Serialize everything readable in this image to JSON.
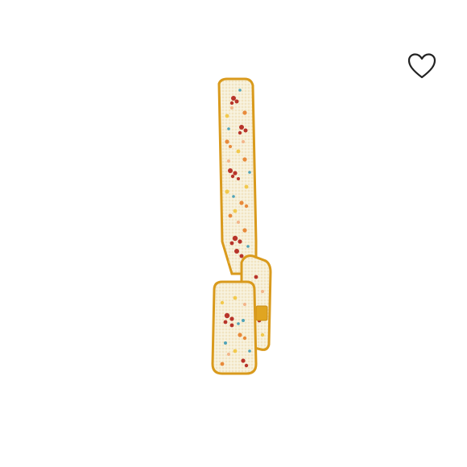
{
  "product": {
    "image_icon": "beaded-floral-shoulder-bag-side-view",
    "colors": {
      "trim": "#E0A521",
      "trim_dark": "#C98C12",
      "bead_base": "#F6EFD9",
      "bead_cream": "#FBF4E2",
      "flower_red": "#B8342A",
      "flower_orange": "#E88A3A",
      "flower_blue": "#4FA3B8",
      "flower_yellow": "#F2C94C",
      "flower_peach": "#F3B58A"
    }
  },
  "wishlist": {
    "icon": "heart-outline-icon",
    "color": "#222222"
  }
}
